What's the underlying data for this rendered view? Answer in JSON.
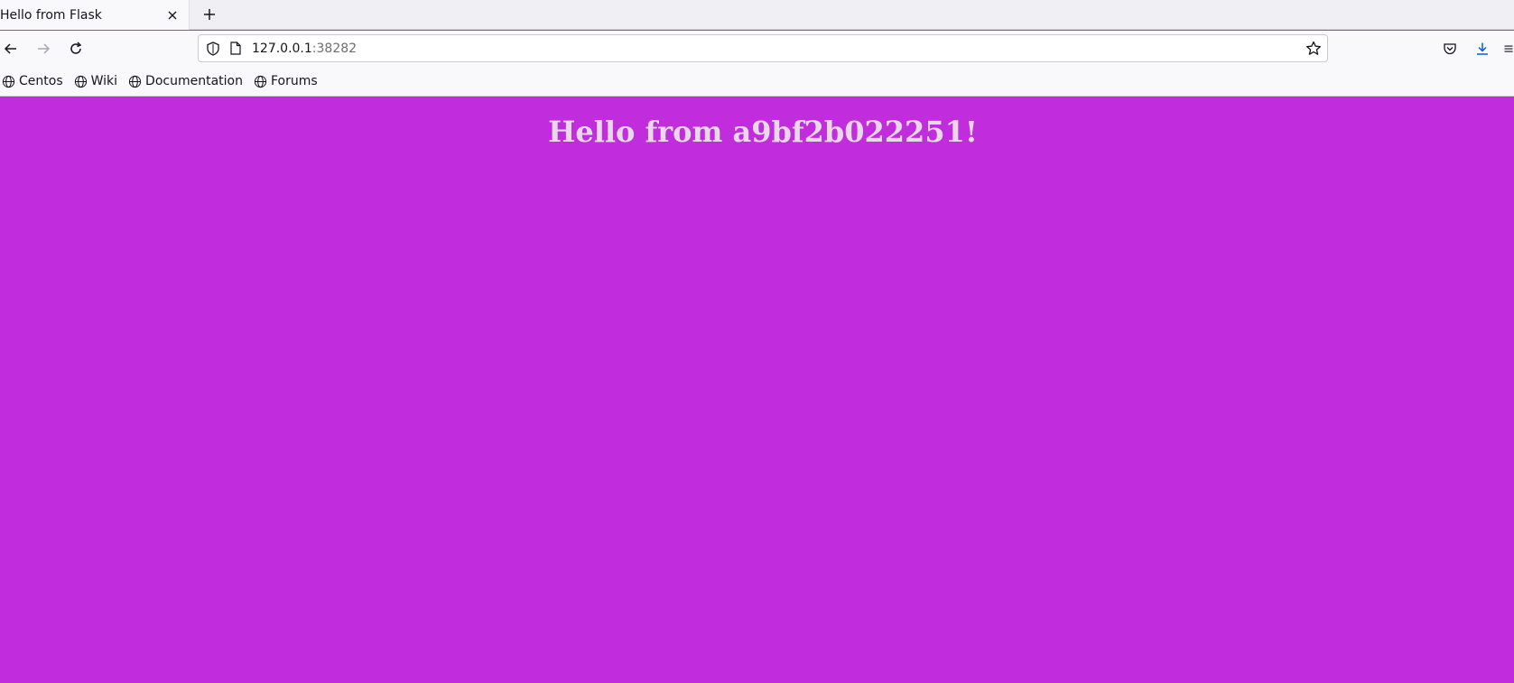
{
  "browser": {
    "tab": {
      "title": "Hello from Flask"
    },
    "url": {
      "host": "127.0.0.1",
      "port": ":38282"
    },
    "bookmarks": [
      {
        "label": "Centos"
      },
      {
        "label": "Wiki"
      },
      {
        "label": "Documentation"
      },
      {
        "label": "Forums"
      }
    ]
  },
  "page": {
    "heading": "Hello from a9bf2b022251!",
    "background_color": "#c12ddd"
  },
  "icons": [
    "close-icon",
    "plus-icon",
    "back-icon",
    "forward-icon",
    "reload-icon",
    "shield-icon",
    "page-icon",
    "star-icon",
    "pocket-icon",
    "download-icon",
    "menu-icon",
    "globe-icon"
  ]
}
